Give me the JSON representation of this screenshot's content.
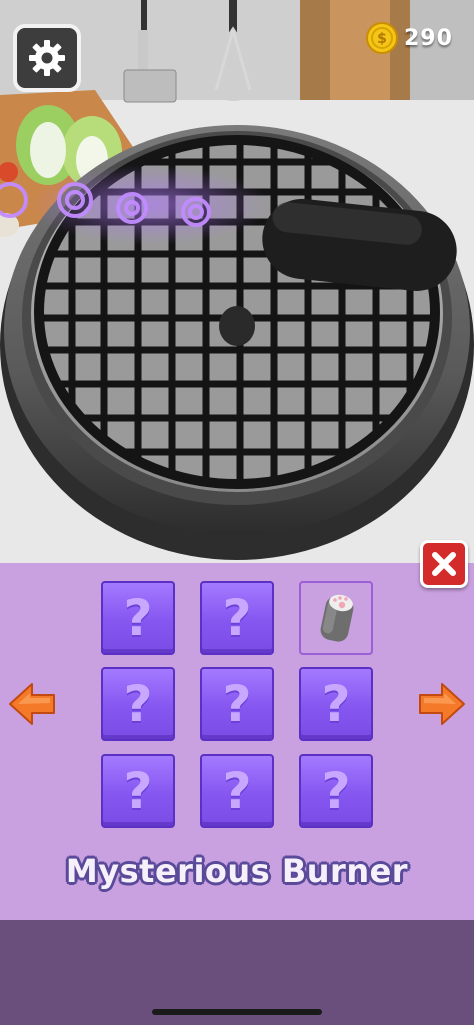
{
  "hud": {
    "coin_count": "290",
    "settings_icon": "gear-icon",
    "coin_icon": "coin-icon"
  },
  "collection": {
    "title": "Mysterious Burner",
    "locked_symbol": "?",
    "slots": [
      {
        "state": "locked"
      },
      {
        "state": "locked"
      },
      {
        "state": "unlocked",
        "icon": "paw-canister-icon"
      },
      {
        "state": "locked"
      },
      {
        "state": "locked"
      },
      {
        "state": "locked"
      },
      {
        "state": "locked"
      },
      {
        "state": "locked"
      },
      {
        "state": "locked"
      }
    ],
    "prev_icon": "arrow-left-icon",
    "next_icon": "arrow-right-icon",
    "close_icon": "close-icon"
  },
  "colors": {
    "panel": "#c9a0e0",
    "locked_slot": "#8656f0",
    "close_button": "#d32b2b",
    "arrow": "#f47a2a",
    "coin": "#f5c518",
    "footer_band": "#6a4f7d"
  }
}
